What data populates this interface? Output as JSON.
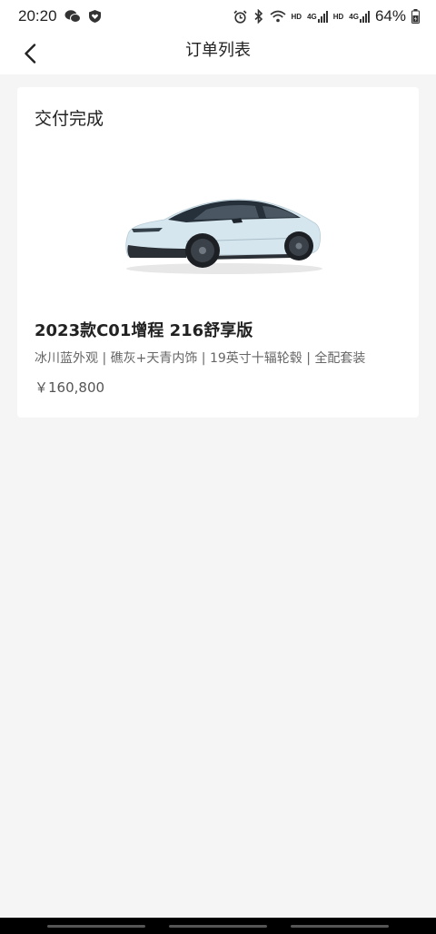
{
  "status_bar": {
    "time": "20:20",
    "hd1": "HD",
    "sig1": "4G",
    "hd2": "HD",
    "sig2": "4G",
    "battery": "64%"
  },
  "nav": {
    "title": "订单列表"
  },
  "order": {
    "status": "交付完成",
    "car_name": "2023款C01增程 216舒享版",
    "config": "冰川蓝外观 | 礁灰+天青内饰 | 19英寸十辐轮毂 | 全配套装",
    "price": "￥160,800",
    "car_color": "#d6e6ee"
  }
}
